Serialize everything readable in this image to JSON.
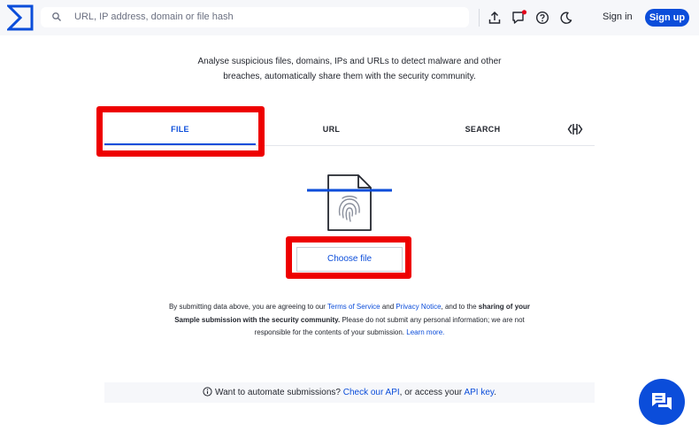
{
  "header": {
    "search_placeholder": "URL, IP address, domain or file hash",
    "sign_in": "Sign in",
    "sign_up": "Sign up",
    "icons": [
      "upload-icon",
      "notifications-icon",
      "help-icon",
      "theme-toggle-icon"
    ]
  },
  "intro": {
    "line1": "Analyse suspicious files, domains, IPs and URLs to detect malware and other",
    "line2": "breaches, automatically share them with the security community."
  },
  "tabs": [
    {
      "label": "FILE",
      "active": true
    },
    {
      "label": "URL",
      "active": false
    },
    {
      "label": "SEARCH",
      "active": false
    }
  ],
  "upload": {
    "choose_file": "Choose file"
  },
  "terms": {
    "t1": "By submitting data above, you are agreeing to our ",
    "terms_link": "Terms of Service",
    "t2": " and ",
    "privacy_link": "Privacy Notice",
    "t3": ", and to the ",
    "bold1": "sharing of your",
    "bold2": "Sample submission with the security community.",
    "t4": " Please do not submit any personal information; we are not",
    "t5": "responsible for the contents of your submission. ",
    "learn_link": "Learn more."
  },
  "automate": {
    "t1": "Want to automate submissions? ",
    "api_link": "Check our API",
    "t2": ", or access your ",
    "key_link": "API key",
    "t3": "."
  },
  "colors": {
    "brand": "#0b4dda",
    "highlight": "#ee0000",
    "topbar": "#f6f7fa"
  }
}
